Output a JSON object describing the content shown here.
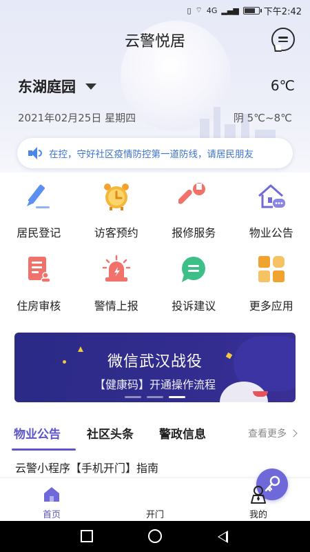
{
  "status_bar": {
    "time": "下午2:42",
    "network": "4G"
  },
  "header": {
    "title": "云警悦居",
    "community": "东湖庭园",
    "temperature": "6℃",
    "date": "2021年02月25日 星期四",
    "weather": "阴   5℃~8℃"
  },
  "notice": {
    "text": "在控，守好社区疫情防控第一道防线，请居民朋友"
  },
  "grid": [
    {
      "label": "居民登记",
      "icon": "pen-icon"
    },
    {
      "label": "访客预约",
      "icon": "alarm-clock-icon"
    },
    {
      "label": "报修服务",
      "icon": "wrench-icon"
    },
    {
      "label": "物业公告",
      "icon": "house-message-icon"
    },
    {
      "label": "住房审核",
      "icon": "document-icon"
    },
    {
      "label": "警情上报",
      "icon": "siren-icon"
    },
    {
      "label": "投诉建议",
      "icon": "chat-bubble-icon"
    },
    {
      "label": "更多应用",
      "icon": "apps-grid-icon"
    }
  ],
  "banner": {
    "title": "微信武汉战役",
    "subtitle": "【健康码】开通操作流程",
    "active_slide": 3,
    "slide_count": 3
  },
  "tabs": [
    {
      "label": "物业公告",
      "active": true
    },
    {
      "label": "社区头条"
    },
    {
      "label": "警政信息"
    }
  ],
  "see_more": "查看更多",
  "news": [
    "云警小程序【手机开门】指南"
  ],
  "bottom_nav": [
    {
      "label": "首页",
      "active": true,
      "icon": "home-icon"
    },
    {
      "label": "开门",
      "icon": "key-icon"
    },
    {
      "label": "我的",
      "icon": "person-icon"
    }
  ],
  "colors": {
    "accent": "#5a55c8",
    "notice_text": "#3d74d6",
    "banner_bg": "#2b2a86"
  }
}
